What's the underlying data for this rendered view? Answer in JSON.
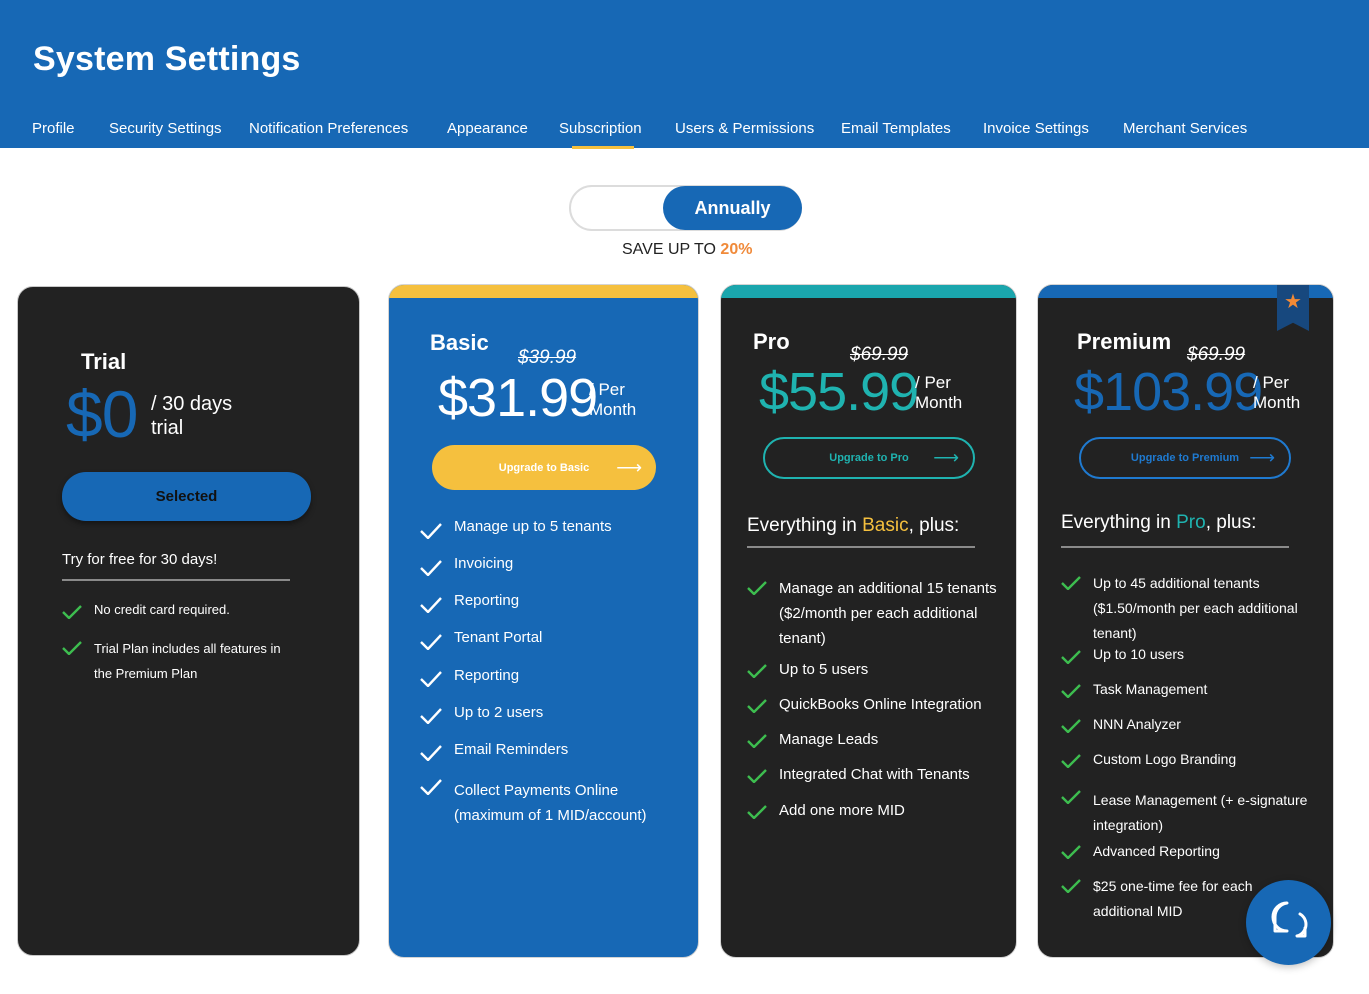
{
  "header": {
    "title": "System Settings"
  },
  "tabs": [
    {
      "label": "Profile"
    },
    {
      "label": "Security Settings"
    },
    {
      "label": "Notification Preferences"
    },
    {
      "label": "Appearance"
    },
    {
      "label": "Subscription"
    },
    {
      "label": "Users & Permissions"
    },
    {
      "label": "Email Templates"
    },
    {
      "label": "Invoice Settings"
    },
    {
      "label": "Merchant Services"
    }
  ],
  "active_tab": "Subscription",
  "billing_toggle": {
    "active_label": "Annually",
    "save_prefix": "SAVE UP TO ",
    "save_pct": "20%"
  },
  "colors": {
    "brand_blue": "#1768b5",
    "yellow": "#f5c03e",
    "teal": "#1fb3b0",
    "dark": "#222222",
    "check_green": "#3dbd4f",
    "orange": "#f08a3a"
  },
  "plans": {
    "trial": {
      "name": "Trial",
      "price": "$0",
      "period_1": "/ 30 days",
      "period_2": "trial",
      "button": "Selected",
      "tagline": "Try for free for 30 days!",
      "features": [
        "No credit card required.",
        "Trial Plan includes all features in",
        "the Premium Plan"
      ]
    },
    "basic": {
      "name": "Basic",
      "old_price": "$39.99",
      "price": "$31.99",
      "per_1": "/ Per",
      "per_2": "Month",
      "button": "Upgrade to Basic",
      "features": [
        "Manage up to 5 tenants",
        "Invoicing",
        "Reporting",
        "Tenant Portal",
        "Reporting",
        "Up to 2 users",
        "Email Reminders",
        "Collect Payments Online",
        "(maximum of 1 MID/account)"
      ]
    },
    "pro": {
      "name": "Pro",
      "old_price": "$69.99",
      "price": "$55.99",
      "per_1": "/ Per",
      "per_2": "Month",
      "button": "Upgrade to Pro",
      "heading_prefix": "Everything in ",
      "heading_hl": "Basic",
      "heading_suffix": ", plus:",
      "features": [
        "Manage an additional 15 tenants",
        "($2/month per each additional",
        "tenant)",
        "Up to 5 users",
        "QuickBooks Online Integration",
        "Manage Leads",
        "Integrated Chat with Tenants",
        "Add one more MID"
      ]
    },
    "premium": {
      "name": "Premium",
      "old_price": "$69.99",
      "price": "$103.99",
      "per_1": "/ Per",
      "per_2": "Month",
      "button": "Upgrade to Premium",
      "heading_prefix": "Everything in ",
      "heading_hl": "Pro",
      "heading_suffix": ", plus:",
      "features": [
        "Up to 45 additional tenants",
        "($1.50/month per each additional",
        "tenant)",
        "Up to 10 users",
        "Task Management",
        "NNN Analyzer",
        "Custom Logo Branding",
        "Lease Management (+ e-signature",
        "integration)",
        "Advanced Reporting",
        "$25 one-time fee for each",
        "additional MID"
      ]
    }
  }
}
